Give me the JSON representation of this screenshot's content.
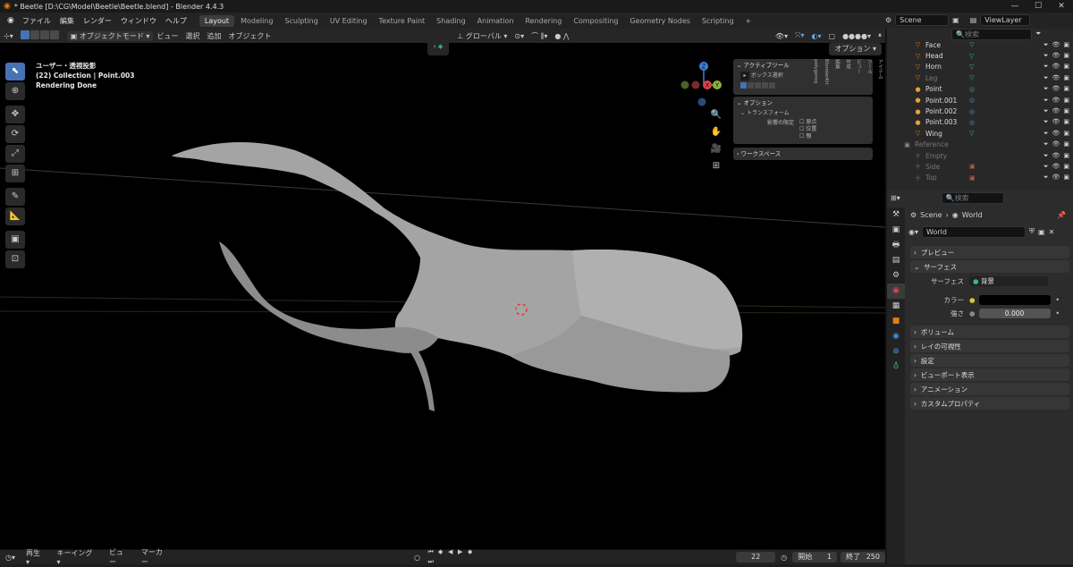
{
  "window": {
    "title": "* Beetle [D:\\CG\\Model\\Beetle\\Beetle.blend] - Blender 4.4.3",
    "controls": [
      "—",
      "☐",
      "✕"
    ]
  },
  "menu": [
    "ファイル",
    "編集",
    "レンダー",
    "ウィンドウ",
    "ヘルプ"
  ],
  "workspaces": [
    "Layout",
    "Modeling",
    "Sculpting",
    "UV Editing",
    "Texture Paint",
    "Shading",
    "Animation",
    "Rendering",
    "Compositing",
    "Geometry Nodes",
    "Scripting",
    "+"
  ],
  "scene": "Scene",
  "view_layer": "ViewLayer",
  "vp_header": {
    "mode": "オブジェクトモード",
    "menus": [
      "ビュー",
      "選択",
      "追加",
      "オブジェクト"
    ],
    "orientation": "グローバル",
    "options": "オプション"
  },
  "vp_info": {
    "line1": "ユーザー・透視投影",
    "line2": "(22) Collection | Point.003",
    "line3": "Rendering Done"
  },
  "gizmo": {
    "z": "Z",
    "y": "Y",
    "x": "X"
  },
  "npanel": {
    "active_tool": "アクティブツール",
    "box_select": "ボックス選択",
    "options": "オプション",
    "transform": "トランスフォーム",
    "affect_only": "影響の限定",
    "origin": "原点",
    "location": "位置",
    "parent": "親",
    "workspace": "ワークスペース"
  },
  "ntabs": [
    "アイテム",
    "ツール",
    "ビュー",
    "作成",
    "編集",
    "BlenderKit",
    "polygoniq"
  ],
  "outliner": {
    "search": "検索",
    "items": [
      {
        "name": "Face",
        "icon": "▽",
        "mod": "▽",
        "dim": false
      },
      {
        "name": "Head",
        "icon": "▽",
        "mod": "▽",
        "dim": false
      },
      {
        "name": "Horn",
        "icon": "▽",
        "mod": "▽",
        "dim": false
      },
      {
        "name": "Leg",
        "icon": "▽",
        "mod": "▽",
        "dim": true
      },
      {
        "name": "Point",
        "icon": "●",
        "mod": "◎",
        "dim": false
      },
      {
        "name": "Point.001",
        "icon": "●",
        "mod": "◎",
        "dim": false
      },
      {
        "name": "Point.002",
        "icon": "●",
        "mod": "◎",
        "dim": false
      },
      {
        "name": "Point.003",
        "icon": "●",
        "mod": "◎",
        "dim": false
      },
      {
        "name": "Wing",
        "icon": "▽",
        "mod": "▽",
        "dim": false
      },
      {
        "name": "Reference",
        "icon": "▣",
        "mod": "",
        "dim": true
      },
      {
        "name": "Empty",
        "icon": "⊹",
        "mod": "",
        "dim": true
      },
      {
        "name": "Side",
        "icon": "⊹",
        "mod": "▣",
        "dim": true
      },
      {
        "name": "Top",
        "icon": "⊹",
        "mod": "▣",
        "dim": true
      }
    ]
  },
  "props": {
    "search": "検索",
    "breadcrumb_scene": "Scene",
    "breadcrumb_world": "World",
    "world_name": "World",
    "sections_top": [
      "プレビュー",
      "サーフェス"
    ],
    "surface_label": "サーフェス",
    "surface_value": "背景",
    "color_label": "カラー",
    "strength_label": "強さ",
    "strength_value": "0.000",
    "sections": [
      "ボリューム",
      "レイの可視性",
      "設定",
      "ビューポート表示",
      "アニメーション",
      "カスタムプロパティ"
    ]
  },
  "status": {
    "playback": "再生",
    "keying": "キーイング",
    "view": "ビュー",
    "marker": "マーカー",
    "current_frame": "22",
    "start_label": "開始",
    "start": "1",
    "end_label": "終了",
    "end": "250"
  },
  "colors": {
    "accent": "#4772b3",
    "x_axis": "#e0404a",
    "y_axis": "#8bb43c",
    "z_axis": "#3d7fd6",
    "mesh": "#9a9a9a"
  }
}
